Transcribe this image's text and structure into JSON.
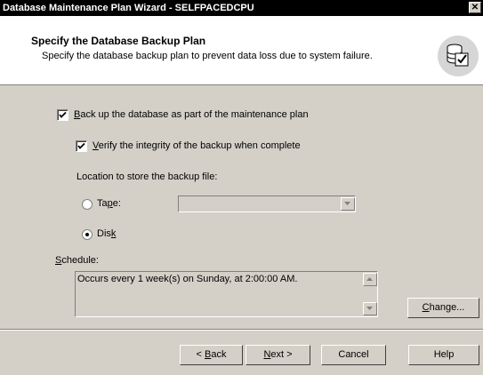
{
  "window": {
    "title": "Database Maintenance Plan Wizard - SELFPACEDCPU",
    "close_glyph": "✕"
  },
  "header": {
    "title": "Specify the Database Backup Plan",
    "subtitle": "Specify the database backup plan to prevent data loss due to system failure.",
    "icon": "database-backup-icon"
  },
  "options": {
    "backup": {
      "pre": "",
      "key": "B",
      "post": "ack up the database as part of the maintenance plan",
      "checked": true
    },
    "verify": {
      "pre": "",
      "key": "V",
      "post": "erify the integrity of the backup when complete",
      "checked": true
    },
    "location_label": "Location to store the backup file:",
    "tape": {
      "pre": "Ta",
      "key": "p",
      "post": "e:",
      "selected": false
    },
    "disk": {
      "pre": "Dis",
      "key": "k",
      "post": "",
      "selected": true
    },
    "tape_combo_value": ""
  },
  "schedule": {
    "label_pre": "",
    "label_key": "S",
    "label_post": "chedule:",
    "text": "Occurs every 1 week(s) on Sunday, at 2:00:00 AM.",
    "change": {
      "pre": "",
      "key": "C",
      "post": "hange..."
    }
  },
  "footer": {
    "back": {
      "pre": "< ",
      "key": "B",
      "post": "ack"
    },
    "next": {
      "pre": "",
      "key": "N",
      "post": "ext >"
    },
    "cancel": "Cancel",
    "help": "Help"
  }
}
